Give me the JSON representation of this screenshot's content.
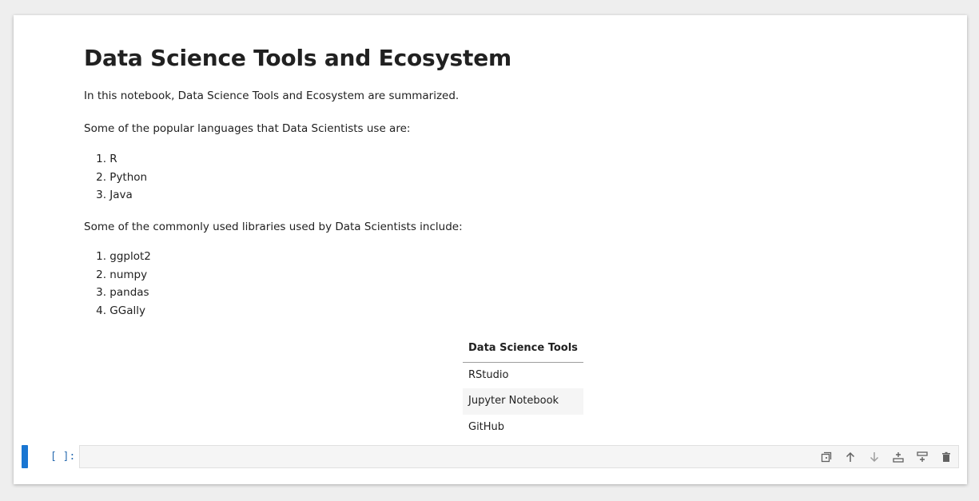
{
  "markdown": {
    "title": "Data Science Tools and Ecosystem",
    "intro": "In this notebook, Data Science Tools and Ecosystem are summarized.",
    "languages_heading": "Some of the popular languages that Data Scientists use are:",
    "languages": [
      {
        "num": "1.",
        "label": "R"
      },
      {
        "num": "2.",
        "label": "Python"
      },
      {
        "num": "3.",
        "label": "Java"
      }
    ],
    "libraries_heading": "Some of the commonly used libraries used by Data Scientists include:",
    "libraries": [
      {
        "num": "1.",
        "label": "ggplot2"
      },
      {
        "num": "2.",
        "label": "numpy"
      },
      {
        "num": "3.",
        "label": "pandas"
      },
      {
        "num": "4.",
        "label": "GGally"
      }
    ],
    "table": {
      "header": "Data Science Tools",
      "rows": [
        "RStudio",
        "Jupyter Notebook",
        "GitHub"
      ]
    }
  },
  "code_cell": {
    "prompt": "[ ]:",
    "toolbar_icons": [
      "duplicate-icon",
      "move-up-icon",
      "move-down-icon",
      "insert-above-icon",
      "insert-below-icon",
      "delete-icon"
    ]
  },
  "colors": {
    "active_cell_bar": "#1976d2",
    "prompt": "#2a6cb0",
    "editor_bg": "#f5f5f5"
  }
}
